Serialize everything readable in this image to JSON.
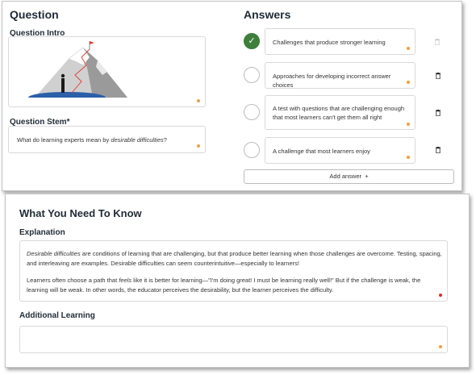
{
  "question": {
    "heading": "Question",
    "intro_label": "Question Intro",
    "stem_label": "Question Stem*",
    "stem_prefix": "What do learning experts mean by ",
    "stem_emphasis": "desirable difficulties",
    "stem_suffix": "?"
  },
  "answers": {
    "heading": "Answers",
    "items": [
      {
        "text": "Challenges that produce stronger learning",
        "correct": true
      },
      {
        "text": "Approaches for developing incorrect answer choices",
        "correct": false
      },
      {
        "text": "A test with questions that are challenging enough that most learners can't get them all right",
        "correct": false
      },
      {
        "text": "A challenge that most learners enjoy",
        "correct": false
      }
    ],
    "add_label": "Add answer",
    "add_symbol": "+"
  },
  "know": {
    "heading": "What You Need To Know",
    "explanation_label": "Explanation",
    "para1_em": "Desirable difficulties",
    "para1_rest": " are conditions of learning that are challenging, but that produce better learning when those challenges are overcome. Testing, spacing, and interleaving are examples. Desirable difficulties can seem counterintuitive—especially to learners!",
    "para2_a": "Learners often choose a path that ",
    "para2_em": "feels",
    "para2_b": " like it is better for learning—\"I'm doing great! I must be learning really well!\" But if the challenge is weak, the learning will be weak. In other words, the educator perceives the desirability, but the learner perceives the difficulty.",
    "additional_label": "Additional Learning"
  },
  "colors": {
    "correct_green": "#3d7f3b",
    "indicator_orange": "#f0a040",
    "indicator_red": "#d93025"
  },
  "icons": {
    "check": "check-icon",
    "trash": "trash-icon",
    "illustration": "mountain-summit-illustration"
  }
}
